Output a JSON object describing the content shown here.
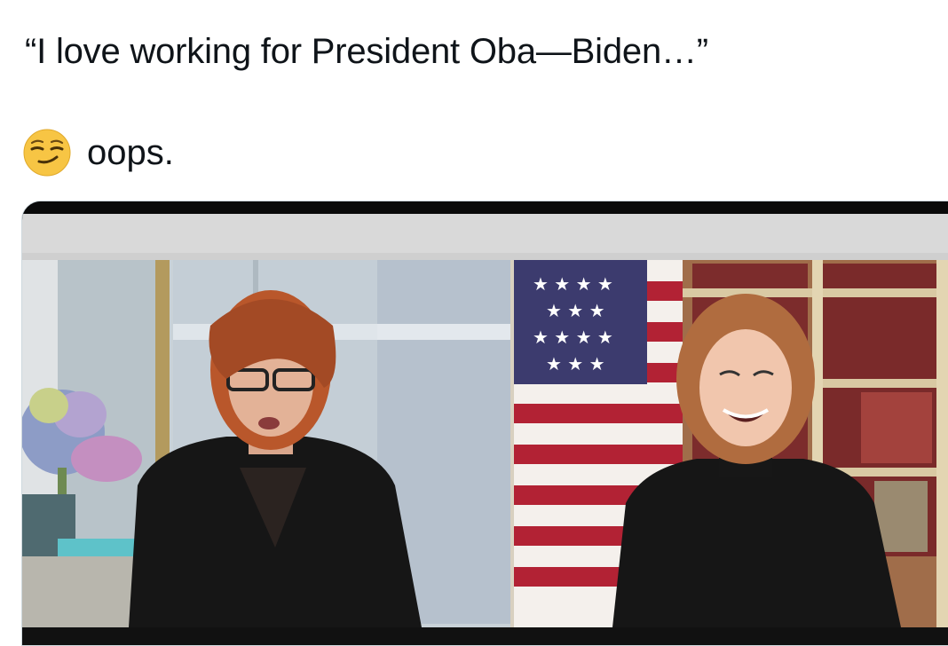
{
  "tweet": {
    "line1": "“I love working for President Oba—Biden…”",
    "line2_text": "oops.",
    "emoji_icon": "smirking-face-emoji"
  },
  "media": {
    "type": "video-still",
    "left_panel_icon": "studio-host-scene",
    "right_panel_icon": "remote-guest-scene",
    "colors": {
      "top_bar": "#0a0a0a",
      "banner": "#d9d9d9",
      "left_background": "#c9d2d8",
      "right_background": "#e9dcc1",
      "flag_red": "#b22234",
      "flag_blue": "#3c3b6e"
    }
  }
}
